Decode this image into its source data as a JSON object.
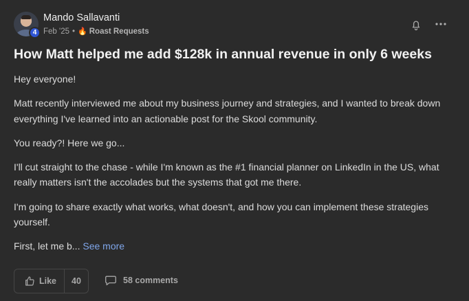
{
  "post": {
    "author": {
      "name": "Mando Sallavanti",
      "level": "4"
    },
    "date": "Feb '25",
    "separator": "•",
    "category_icon": "🔥",
    "category": "Roast Requests",
    "title": "How Matt helped me add $128k in annual revenue in only 6 weeks",
    "paragraphs": [
      "Hey everyone!",
      "Matt recently interviewed me about my business journey and strategies, and I wanted to break down everything I've learned into an actionable post for the Skool community.",
      "You ready?! Here we go...",
      "I'll cut straight to the chase - while I'm known as the #1 financial planner on LinkedIn in the US, what really matters isn't the accolades but the systems that got me there.",
      "I'm going to share exactly what works, what doesn't, and how you can implement these strategies yourself."
    ],
    "truncated_text": "First, let me b...",
    "see_more": "See more",
    "like_label": "Like",
    "like_count": "40",
    "comments_label": "58 comments"
  },
  "icons": {
    "bell": "bell-icon",
    "more": "more-icon",
    "like": "thumbs-up-icon",
    "comments": "comment-icon"
  },
  "colors": {
    "background": "#2b2b2b",
    "link": "#7fa6ea",
    "level_badge": "#2f55d4"
  }
}
